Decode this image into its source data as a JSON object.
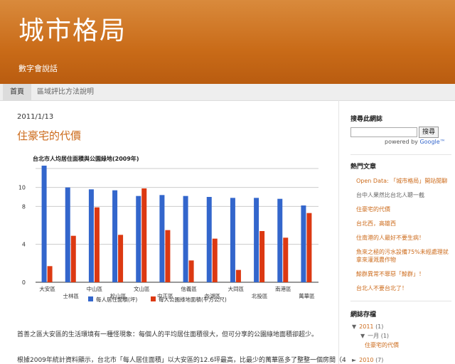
{
  "blog": {
    "title": "城市格局",
    "description": "數字會說話"
  },
  "tabs": [
    {
      "label": "首頁"
    },
    {
      "label": "區域評比方法說明"
    }
  ],
  "post": {
    "date": "2011/1/13",
    "title": "住豪宅的代價",
    "paragraph1": "首善之區大安區的生活環境有一種怪現象：每個人的平均居住面積很大，但可分享的公園綠地面積卻超少。",
    "paragraph2": "根據2009年統計資料顯示，台北市「每人居住面積」以大安區的12.6坪最高，比最少的萬華區多了整整一個房間（4"
  },
  "chart_data": {
    "type": "bar",
    "title": "台北市人均居住面積與公園綠地(2009年)",
    "categories": [
      "大安區",
      "士林區",
      "中山區",
      "松山區",
      "文山區",
      "中正區",
      "信義區",
      "內湖區",
      "大同區",
      "北投區",
      "南港區",
      "萬華區"
    ],
    "series": [
      {
        "name": "每人居住面積(坪)",
        "color": "#3366cc",
        "values": [
          12.3,
          10.0,
          9.8,
          9.7,
          9.1,
          9.2,
          9.1,
          9.0,
          8.9,
          8.9,
          8.8,
          8.1
        ]
      },
      {
        "name": "每人公園綠地面積(平方公尺)",
        "color": "#dc3912",
        "values": [
          1.7,
          4.9,
          7.9,
          5.0,
          9.9,
          5.5,
          2.3,
          4.6,
          1.3,
          5.4,
          4.7,
          7.3
        ]
      }
    ],
    "ylim": [
      0,
      12
    ],
    "yticks": [
      0,
      4,
      8,
      10,
      12
    ],
    "grid": true,
    "legend": "bottom"
  },
  "sidebar": {
    "search_heading": "搜尋此網誌",
    "search_button": "搜尋",
    "powered_by": "powered by",
    "google": "Google™",
    "popular_heading": "熱門文章",
    "popular": [
      {
        "label": "Open Data: 「城市格局」開站閒聊",
        "style": "link"
      },
      {
        "label": "台中人果然比台北人聰一截",
        "style": "grey"
      },
      {
        "label": "住豪宅的代價",
        "style": "link"
      },
      {
        "label": "台北西，高雄西",
        "style": "link"
      },
      {
        "label": "住南港的人最好不要生病！",
        "style": "link"
      },
      {
        "label": "魚來之極的污水設備75%未經處理就拿來灌溉農作物",
        "style": "link"
      },
      {
        "label": "鯨群異常不罪惡「鯨群」！",
        "style": "link"
      },
      {
        "label": "台北人不要台北了！",
        "style": "link"
      }
    ],
    "archive_heading": "網誌存檔",
    "archive": {
      "y2011": {
        "year": "2011",
        "count": "(1)"
      },
      "jan": {
        "month": "一月",
        "count": "(1)"
      },
      "post": "住豪宅的代價",
      "y2010": {
        "year": "2010",
        "count": "(7)"
      }
    }
  }
}
